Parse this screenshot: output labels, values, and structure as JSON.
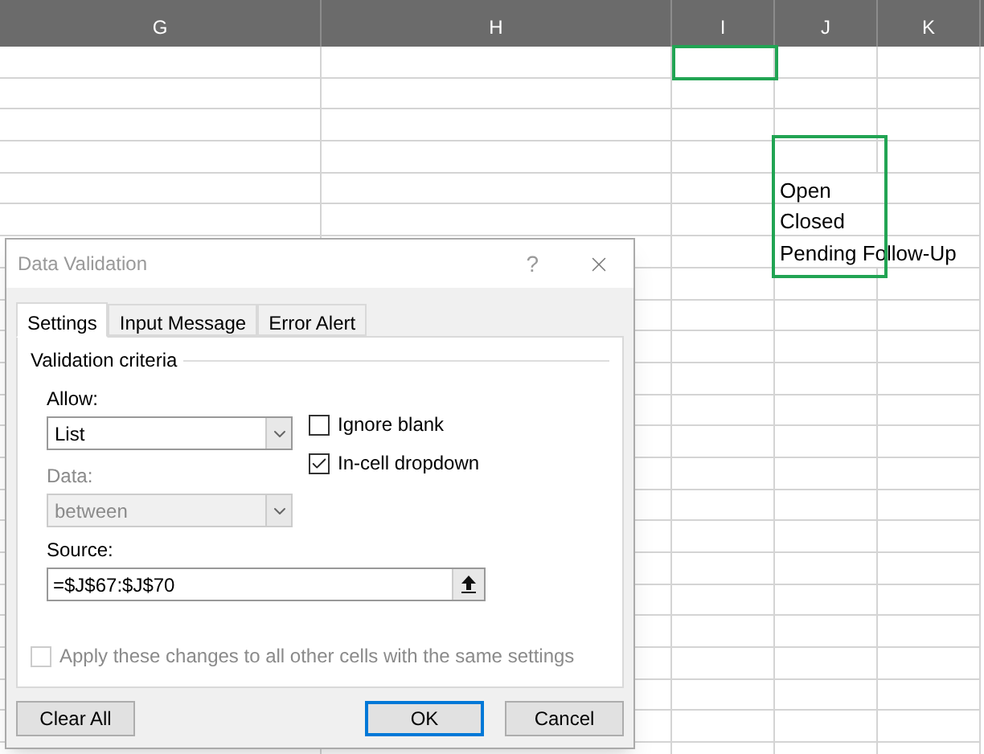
{
  "sheet": {
    "columns": [
      "G",
      "H",
      "I",
      "J",
      "K"
    ],
    "list_values": [
      "Open",
      "Closed",
      "Pending Follow-Up"
    ]
  },
  "dialog": {
    "title": "Data Validation",
    "help": "?",
    "tabs": [
      {
        "label": "Settings",
        "selected": true
      },
      {
        "label": "Input Message",
        "selected": false
      },
      {
        "label": "Error Alert",
        "selected": false
      }
    ],
    "section": "Validation criteria",
    "allow": {
      "label": "Allow:",
      "value": "List"
    },
    "ignore_blank": {
      "label": "Ignore blank",
      "checked": false
    },
    "in_cell_dropdown": {
      "label": "In-cell dropdown",
      "checked": true
    },
    "data": {
      "label": "Data:",
      "value": "between",
      "disabled": true
    },
    "source": {
      "label": "Source:",
      "value": "=$J$67:$J$70"
    },
    "apply_all": {
      "label": "Apply these changes to all other cells with the same settings",
      "checked": false,
      "disabled": true
    },
    "buttons": [
      {
        "label": "Clear All",
        "default": false
      },
      {
        "label": "OK",
        "default": true
      },
      {
        "label": "Cancel",
        "default": false
      }
    ]
  }
}
